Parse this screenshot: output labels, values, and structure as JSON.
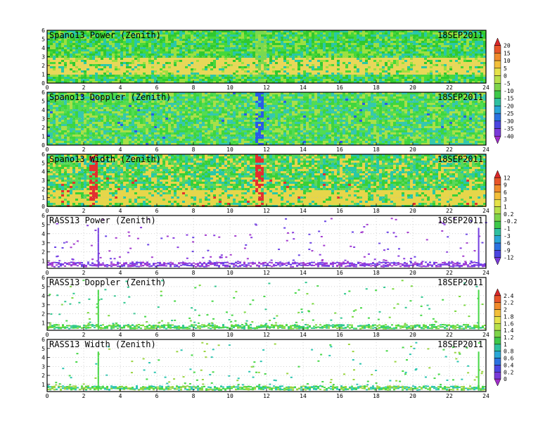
{
  "figure": {
    "date": "18SEP2011"
  },
  "chart_data": [
    {
      "type": "heatmap",
      "title": "Spano13 Power (Zenith)",
      "date_label": "18SEP2011",
      "x_ticks": [
        "0",
        "2",
        "4",
        "6",
        "8",
        "10",
        "12",
        "14",
        "16",
        "18",
        "20",
        "22",
        "24"
      ],
      "y_ticks": [
        "0",
        "1",
        "2",
        "3",
        "4",
        "5",
        "6"
      ],
      "xlim": [
        0,
        24
      ],
      "ylim": [
        0,
        6
      ],
      "colorbar": 1,
      "fill": "dense",
      "base_colors": [
        "#2fc92f",
        "#46d83a",
        "#9be040",
        "#28c8a8"
      ],
      "band_color": "#e8d858",
      "band_rows": [
        1.0,
        3.0
      ],
      "spike_color": "#7ad94f",
      "spikes": [
        11.6
      ]
    },
    {
      "type": "heatmap",
      "title": "Spano13 Doppler (Zenith)",
      "date_label": "18SEP2011",
      "x_ticks": [
        "0",
        "2",
        "4",
        "6",
        "8",
        "10",
        "12",
        "14",
        "16",
        "18",
        "20",
        "22",
        "24"
      ],
      "y_ticks": [
        "0",
        "1",
        "2",
        "3",
        "4",
        "5",
        "6"
      ],
      "xlim": [
        0,
        24
      ],
      "ylim": [
        0,
        6
      ],
      "colorbar": 1,
      "fill": "dense",
      "base_colors": [
        "#3ed63e",
        "#52dc52",
        "#34c8b0",
        "#a8e048"
      ],
      "band_color": "#1e7fe0",
      "band_rows": [
        0,
        0
      ],
      "spike_color": "#2a5be8",
      "spikes": [
        11.5
      ]
    },
    {
      "type": "heatmap",
      "title": "Spano13 Width (Zenith)",
      "date_label": "18SEP2011",
      "x_ticks": [
        "0",
        "2",
        "4",
        "6",
        "8",
        "10",
        "12",
        "14",
        "16",
        "18",
        "20",
        "22",
        "24"
      ],
      "y_ticks": [
        "0",
        "1",
        "2",
        "3",
        "4",
        "5",
        "6"
      ],
      "xlim": [
        0,
        24
      ],
      "ylim": [
        0,
        6
      ],
      "colorbar": 2,
      "fill": "dense",
      "base_colors": [
        "#38d038",
        "#28c8a8",
        "#5ad85a",
        "#e6d64a"
      ],
      "band_color": "#e6d64a",
      "band_rows": [
        0.3,
        2.0
      ],
      "spike_color": "#e23030",
      "spikes": [
        2.5,
        11.5
      ]
    },
    {
      "type": "heatmap",
      "title": "RASS13 Power (Zenith)",
      "date_label": "18SEP2011",
      "x_ticks": [
        "0",
        "2",
        "4",
        "6",
        "8",
        "10",
        "12",
        "14",
        "16",
        "18",
        "20",
        "22",
        "24"
      ],
      "y_ticks": [
        "1",
        "2",
        "3",
        "4",
        "5",
        "6"
      ],
      "xlim": [
        0,
        24
      ],
      "ylim": [
        0.2,
        6
      ],
      "colorbar": 2,
      "fill": "sparse",
      "base_colors": [
        "#8a3de0",
        "#6a42e6",
        "#a43ccf"
      ],
      "band_color": "#7440e0",
      "band_rows": [
        0.45,
        0.95
      ],
      "spike_color": "#7440e0",
      "spikes": [
        2.8,
        23.6
      ]
    },
    {
      "type": "heatmap",
      "title": "RASS13 Doppler (Zenith)",
      "date_label": "18SEP2011",
      "x_ticks": [
        "0",
        "2",
        "4",
        "6",
        "8",
        "10",
        "12",
        "14",
        "16",
        "18",
        "20",
        "22",
        "24"
      ],
      "y_ticks": [
        "1",
        "2",
        "3",
        "4",
        "5",
        "6"
      ],
      "xlim": [
        0,
        24
      ],
      "ylim": [
        0.2,
        6
      ],
      "colorbar": 3,
      "fill": "sparse",
      "base_colors": [
        "#46d846",
        "#7ad93e",
        "#30c890"
      ],
      "band_color": "#48d848",
      "band_rows": [
        0.45,
        0.9
      ],
      "spike_color": "#48d848",
      "spikes": [
        2.8,
        23.6
      ]
    },
    {
      "type": "heatmap",
      "title": "RASS13 Width (Zenith)",
      "date_label": "18SEP2011",
      "x_ticks": [
        "0",
        "2",
        "4",
        "6",
        "8",
        "10",
        "12",
        "14",
        "16",
        "18",
        "20",
        "22",
        "24"
      ],
      "y_ticks": [
        "1",
        "2",
        "3",
        "4",
        "5",
        "6"
      ],
      "xlim": [
        0,
        24
      ],
      "ylim": [
        0.2,
        6
      ],
      "colorbar": 3,
      "fill": "sparse",
      "base_colors": [
        "#46d846",
        "#2cc6b0",
        "#9ad540"
      ],
      "band_color": "#48d848",
      "band_rows": [
        0.45,
        0.9
      ],
      "spike_color": "#48d848",
      "spikes": [
        2.8,
        23.6
      ]
    }
  ],
  "colorbars": [
    {
      "labels": [
        "20",
        "15",
        "10",
        "5",
        "0",
        "-5",
        "-10",
        "-15",
        "-20",
        "-25",
        "-30",
        "-35",
        "-40"
      ],
      "colors": [
        "#d9282a",
        "#e8552a",
        "#f08b2c",
        "#f3bf3a",
        "#e6e24a",
        "#b8e04a",
        "#7ed44a",
        "#3fc84a",
        "#2fc0a0",
        "#2aa6d6",
        "#2b72e0",
        "#4b45e0",
        "#7a3ad8",
        "#a02cc8"
      ]
    },
    {
      "labels": [
        "12",
        "9",
        "6",
        "3",
        "1",
        "0.2",
        "-0.2",
        "-1",
        "-3",
        "-6",
        "-9",
        "-12"
      ],
      "colors": [
        "#d9282a",
        "#e8552a",
        "#f08b2c",
        "#f3bf3a",
        "#e6e24a",
        "#b8e04a",
        "#7ed44a",
        "#3fc84a",
        "#2fc0a0",
        "#2aa6d6",
        "#2b72e0",
        "#4b45e0",
        "#7a3ad8"
      ]
    },
    {
      "labels": [
        "2.4",
        "2.2",
        "2",
        "1.8",
        "1.6",
        "1.4",
        "1.2",
        "1",
        "0.8",
        "0.6",
        "0.4",
        "0.2",
        "0"
      ],
      "colors": [
        "#d9282a",
        "#e8552a",
        "#f08b2c",
        "#f3bf3a",
        "#e6e24a",
        "#b8e04a",
        "#7ed44a",
        "#3fc84a",
        "#2fc0a0",
        "#2aa6d6",
        "#2b72e0",
        "#4b45e0",
        "#7a3ad8",
        "#a02cc8"
      ]
    }
  ]
}
